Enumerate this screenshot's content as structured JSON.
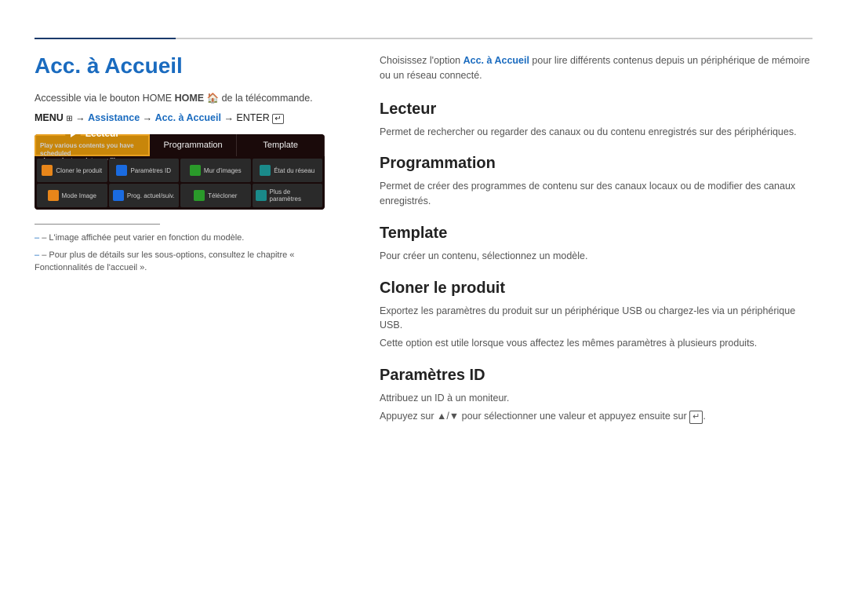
{
  "top_rule": {},
  "left": {
    "title": "Acc. à Accueil",
    "accessible_label": "Accessible via le bouton HOME",
    "accessible_suffix": " de la télécommande.",
    "menu_path_prefix": "MENU",
    "menu_path_arrow1": " → ",
    "menu_assistance": "Assistance",
    "menu_path_arrow2": " → ",
    "menu_acc": "Acc. à Accueil",
    "menu_path_arrow3": " → ENTER",
    "tv_tabs": [
      {
        "label": "Lecteur",
        "sublabel": "Play various contents you have scheduled channels, templates or files.",
        "active": true
      },
      {
        "label": "Programmation",
        "active": false
      },
      {
        "label": "Template",
        "active": false
      }
    ],
    "tv_grid_items": [
      {
        "label": "Cloner le produit",
        "icon_class": "icon-orange"
      },
      {
        "label": "Paramètres ID",
        "icon_class": "icon-blue"
      },
      {
        "label": "Mur d'images",
        "icon_class": "icon-green"
      },
      {
        "label": "État du réseau",
        "icon_class": "icon-teal"
      },
      {
        "label": "Mode Image",
        "icon_class": "icon-orange"
      },
      {
        "label": "Prog. actuel/suiv.",
        "icon_class": "icon-blue"
      },
      {
        "label": "Télécloner",
        "icon_class": "icon-green"
      },
      {
        "label": "Plus de paramètres",
        "icon_class": "icon-teal"
      }
    ],
    "note1": "– L'image affichée peut varier en fonction du modèle.",
    "note2": "– Pour plus de détails sur les sous-options, consultez le chapitre « Fonctionnalités de l'accueil »."
  },
  "right": {
    "intro": "Choisissez l'option",
    "intro_highlight": "Acc. à Accueil",
    "intro_rest": " pour lire différents contenus depuis un périphérique de mémoire ou un réseau connecté.",
    "sections": [
      {
        "id": "lecteur",
        "title": "Lecteur",
        "desc": "Permet de rechercher ou regarder des canaux ou du contenu enregistrés sur des périphériques."
      },
      {
        "id": "programmation",
        "title": "Programmation",
        "desc": "Permet de créer des programmes de contenu sur des canaux locaux ou de modifier des canaux enregistrés."
      },
      {
        "id": "template",
        "title": "Template",
        "desc": "Pour créer un contenu, sélectionnez un modèle."
      },
      {
        "id": "cloner",
        "title": "Cloner le produit",
        "desc1": "Exportez les paramètres du produit sur un périphérique USB ou chargez-les via un périphérique USB.",
        "desc2": "Cette option est utile lorsque vous affectez les mêmes paramètres à plusieurs produits."
      },
      {
        "id": "parametres",
        "title": "Paramètres ID",
        "desc1": "Attribuez un ID à un moniteur.",
        "desc2": "Appuyez sur ▲/▼ pour sélectionner une valeur et appuyez ensuite sur"
      }
    ]
  }
}
